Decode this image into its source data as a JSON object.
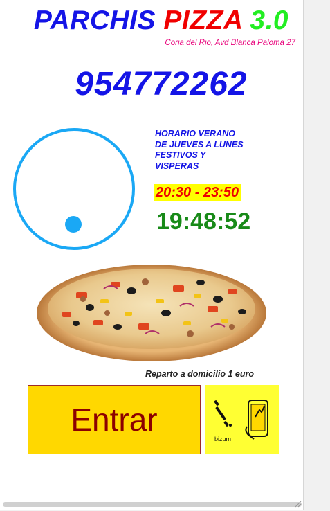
{
  "header": {
    "title_word1": "PARCHIS",
    "title_word2": "PIZZA",
    "title_word3": "3.0",
    "address": "Coria del Rio, Avd Blanca Paloma 27"
  },
  "phone": "954772262",
  "schedule": {
    "line1": "HORARIO VERANO",
    "line2": "DE JUEVES A LUNES",
    "line3": "FESTIVOS Y",
    "line4": "VISPERAS",
    "hours": "20:30 - 23:50"
  },
  "clock": {
    "time": "19:48:52",
    "ring_color": "#1aa8f5"
  },
  "delivery_note": "Reparto a domicilio 1 euro",
  "buttons": {
    "enter_label": "Entrar",
    "bizum_label": "bizum"
  },
  "icons": {
    "bizum": "bizum-logo-icon",
    "phone": "phone-tap-icon"
  },
  "colors": {
    "blue": "#1414e6",
    "red": "#f00000",
    "green": "#22ee22",
    "magenta": "#e8007a",
    "yellow": "#ffd800",
    "dark_red": "#8b0000"
  }
}
